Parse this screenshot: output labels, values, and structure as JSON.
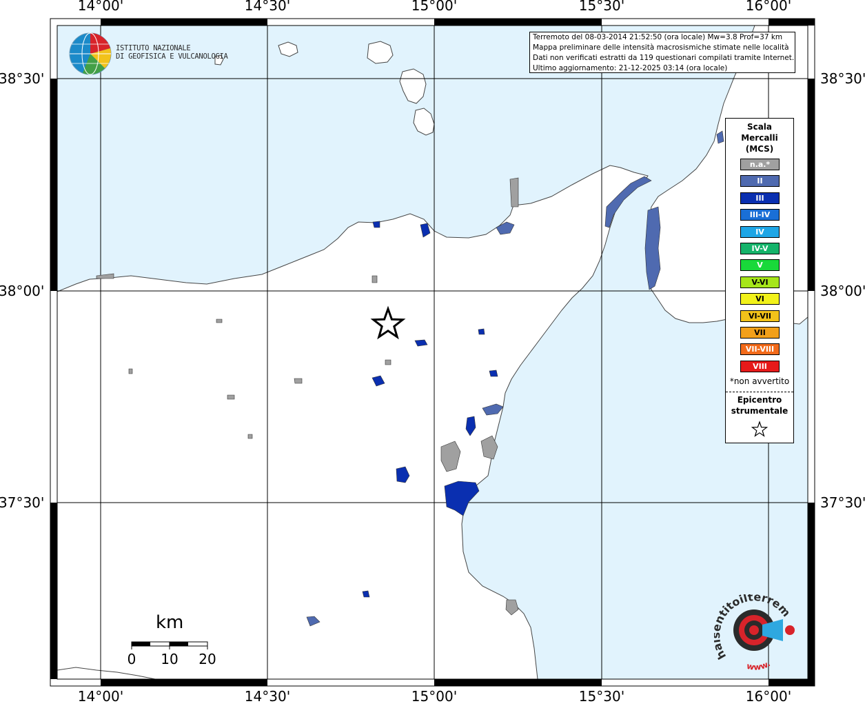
{
  "map": {
    "lon_labels": [
      "14°00'",
      "14°30'",
      "15°00'",
      "15°30'",
      "16°00'"
    ],
    "lat_labels": [
      "38°30'",
      "38°00'",
      "37°30'"
    ],
    "colors": {
      "sea": "#e1f3fd",
      "land": "#ffffff",
      "grid": "#000000",
      "felt_dark": "#0a2fb0",
      "felt_mid": "#4f6ab0",
      "not_felt": "#a0a0a0"
    }
  },
  "institute": {
    "line1": "ISTITUTO NAZIONALE",
    "line2": "DI GEOFISICA E VULCANOLOGIA"
  },
  "info_box": {
    "line1": "Terremoto del 08-03-2014 21:52:50 (ora locale) Mw=3.8 Prof=37 km",
    "line2": "Mappa preliminare delle intensità macrosismiche stimate nelle località",
    "line3": "Dati non verificati estratti da 119 questionari compilati tramite Internet.",
    "line4": "Ultimo aggiornamento: 21-12-2025 03:14 (ora locale)"
  },
  "legend": {
    "title_line1": "Scala",
    "title_line2": "Mercalli",
    "title_line3": "(MCS)",
    "classes": [
      {
        "label": "n.a.*",
        "color": "#a0a0a0"
      },
      {
        "label": "II",
        "color": "#4f6ab0"
      },
      {
        "label": "III",
        "color": "#0a2fb0"
      },
      {
        "label": "III-IV",
        "color": "#1a6fd6"
      },
      {
        "label": "IV",
        "color": "#1ea6e6"
      },
      {
        "label": "IV-V",
        "color": "#15b36a"
      },
      {
        "label": "V",
        "color": "#19d93a"
      },
      {
        "label": "V-VI",
        "color": "#a6e61a"
      },
      {
        "label": "VI",
        "color": "#f2f21a"
      },
      {
        "label": "VI-VII",
        "color": "#f2c21a"
      },
      {
        "label": "VII",
        "color": "#f2a01a"
      },
      {
        "label": "VII-VIII",
        "color": "#f26a1a"
      },
      {
        "label": "VIII",
        "color": "#e61a1a"
      }
    ],
    "na_note": "*non avvertito",
    "epicenter_line1": "Epicentro",
    "epicenter_line2": "strumentale"
  },
  "scalebar": {
    "unit": "km",
    "ticks": [
      "0",
      "10",
      "20"
    ]
  },
  "watermark": {
    "arc_text": "haisentitoilterremoto.it",
    "url_text": "www."
  }
}
